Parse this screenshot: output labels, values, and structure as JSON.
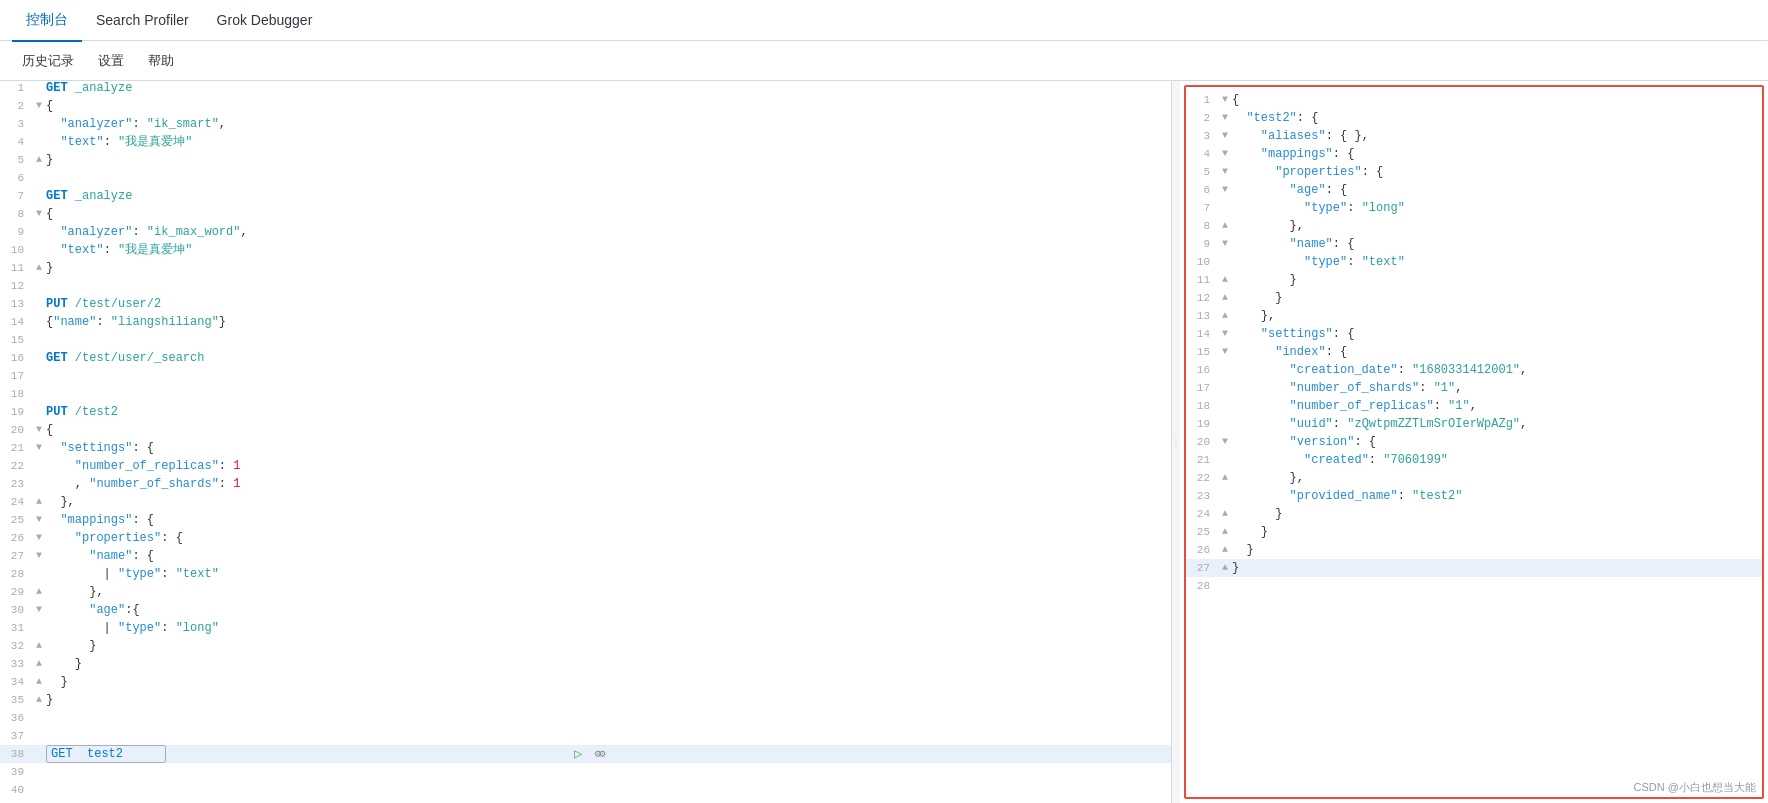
{
  "nav": {
    "tabs": [
      {
        "id": "console",
        "label": "控制台",
        "active": true
      },
      {
        "id": "search-profiler",
        "label": "Search Profiler",
        "active": false
      },
      {
        "id": "grok-debugger",
        "label": "Grok Debugger",
        "active": false
      }
    ]
  },
  "toolbar": {
    "history_label": "历史记录",
    "settings_label": "设置",
    "help_label": "帮助"
  },
  "editor": {
    "lines": [
      {
        "num": 1,
        "fold": "",
        "content": "GET _analyze",
        "classes": [
          "c-method-path"
        ]
      },
      {
        "num": 2,
        "fold": "▼",
        "content": "{",
        "classes": []
      },
      {
        "num": 3,
        "fold": "",
        "content": "  \"analyzer\": \"ik_smart\",",
        "classes": []
      },
      {
        "num": 4,
        "fold": "",
        "content": "  \"text\": \"我是真爱坤\"",
        "classes": []
      },
      {
        "num": 5,
        "fold": "▲",
        "content": "}",
        "classes": []
      },
      {
        "num": 6,
        "fold": "",
        "content": "",
        "classes": []
      },
      {
        "num": 7,
        "fold": "",
        "content": "GET _analyze",
        "classes": []
      },
      {
        "num": 8,
        "fold": "▼",
        "content": "{",
        "classes": []
      },
      {
        "num": 9,
        "fold": "",
        "content": "  \"analyzer\": \"ik_max_word\",",
        "classes": []
      },
      {
        "num": 10,
        "fold": "",
        "content": "  \"text\": \"我是真爱坤\"",
        "classes": []
      },
      {
        "num": 11,
        "fold": "▲",
        "content": "}",
        "classes": []
      },
      {
        "num": 12,
        "fold": "",
        "content": "",
        "classes": []
      },
      {
        "num": 13,
        "fold": "",
        "content": "PUT /test/user/2",
        "classes": []
      },
      {
        "num": 14,
        "fold": "",
        "content": "{\"name\":\"liangshiliang\"}",
        "classes": []
      },
      {
        "num": 15,
        "fold": "",
        "content": "",
        "classes": []
      },
      {
        "num": 16,
        "fold": "",
        "content": "GET /test/user/_search",
        "classes": []
      },
      {
        "num": 17,
        "fold": "",
        "content": "",
        "classes": []
      },
      {
        "num": 18,
        "fold": "",
        "content": "",
        "classes": []
      },
      {
        "num": 19,
        "fold": "",
        "content": "PUT /test2",
        "classes": []
      },
      {
        "num": 20,
        "fold": "▼",
        "content": "{",
        "classes": []
      },
      {
        "num": 21,
        "fold": "▼",
        "content": "  \"settings\": {",
        "classes": []
      },
      {
        "num": 22,
        "fold": "",
        "content": "    \"number_of_replicas\": 1",
        "classes": []
      },
      {
        "num": 23,
        "fold": "",
        "content": "    , \"number_of_shards\": 1",
        "classes": []
      },
      {
        "num": 24,
        "fold": "▲",
        "content": "  },",
        "classes": []
      },
      {
        "num": 25,
        "fold": "▼",
        "content": "  \"mappings\": {",
        "classes": []
      },
      {
        "num": 26,
        "fold": "▼",
        "content": "    \"properties\": {",
        "classes": []
      },
      {
        "num": 27,
        "fold": "▼",
        "content": "      \"name\": {",
        "classes": []
      },
      {
        "num": 28,
        "fold": "",
        "content": "        | \"type\": \"text\"",
        "classes": []
      },
      {
        "num": 29,
        "fold": "▲",
        "content": "      },",
        "classes": []
      },
      {
        "num": 30,
        "fold": "▼",
        "content": "      \"age\":{",
        "classes": []
      },
      {
        "num": 31,
        "fold": "",
        "content": "        | \"type\": \"long\"",
        "classes": []
      },
      {
        "num": 32,
        "fold": "▲",
        "content": "      }",
        "classes": []
      },
      {
        "num": 33,
        "fold": "▲",
        "content": "    }",
        "classes": []
      },
      {
        "num": 34,
        "fold": "▲",
        "content": "  }",
        "classes": []
      },
      {
        "num": 35,
        "fold": "▲",
        "content": "}",
        "classes": []
      },
      {
        "num": 36,
        "fold": "",
        "content": "",
        "classes": []
      },
      {
        "num": 37,
        "fold": "",
        "content": "",
        "classes": []
      },
      {
        "num": 38,
        "fold": "",
        "content": "GET  test2",
        "classes": [
          "active-line"
        ],
        "is_input": true
      },
      {
        "num": 39,
        "fold": "",
        "content": "",
        "classes": []
      },
      {
        "num": 40,
        "fold": "",
        "content": "",
        "classes": []
      }
    ]
  },
  "result": {
    "lines": [
      {
        "num": 1,
        "fold": "▼",
        "content": "{"
      },
      {
        "num": 2,
        "fold": "▼",
        "content": "  \"test2\" : {"
      },
      {
        "num": 3,
        "fold": "▼",
        "content": "    \"aliases\" : { },"
      },
      {
        "num": 4,
        "fold": "▼",
        "content": "    \"mappings\" : {"
      },
      {
        "num": 5,
        "fold": "▼",
        "content": "      \"properties\" : {"
      },
      {
        "num": 6,
        "fold": "▼",
        "content": "        \"age\" : {"
      },
      {
        "num": 7,
        "fold": "",
        "content": "          \"type\" : \"long\""
      },
      {
        "num": 8,
        "fold": "▲",
        "content": "        },"
      },
      {
        "num": 9,
        "fold": "▼",
        "content": "        \"name\" : {"
      },
      {
        "num": 10,
        "fold": "",
        "content": "          \"type\" : \"text\""
      },
      {
        "num": 11,
        "fold": "▲",
        "content": "        }"
      },
      {
        "num": 12,
        "fold": "▲",
        "content": "      }"
      },
      {
        "num": 13,
        "fold": "▲",
        "content": "    },"
      },
      {
        "num": 14,
        "fold": "▼",
        "content": "    \"settings\" : {"
      },
      {
        "num": 15,
        "fold": "▼",
        "content": "      \"index\" : {"
      },
      {
        "num": 16,
        "fold": "",
        "content": "        \"creation_date\" : \"1680331412001\","
      },
      {
        "num": 17,
        "fold": "",
        "content": "        \"number_of_shards\" : \"1\","
      },
      {
        "num": 18,
        "fold": "",
        "content": "        \"number_of_replicas\" : \"1\","
      },
      {
        "num": 19,
        "fold": "",
        "content": "        \"uuid\" : \"zQwtpmZZTLmSrOIerWpAZg\","
      },
      {
        "num": 20,
        "fold": "▼",
        "content": "        \"version\" : {"
      },
      {
        "num": 21,
        "fold": "",
        "content": "          \"created\" : \"7060199\""
      },
      {
        "num": 22,
        "fold": "▲",
        "content": "        },"
      },
      {
        "num": 23,
        "fold": "",
        "content": "        \"provided_name\" : \"test2\""
      },
      {
        "num": 24,
        "fold": "▲",
        "content": "      }"
      },
      {
        "num": 25,
        "fold": "▲",
        "content": "    }"
      },
      {
        "num": 26,
        "fold": "▲",
        "content": "  }"
      },
      {
        "num": 27,
        "fold": "▲",
        "content": "}"
      },
      {
        "num": 28,
        "fold": "",
        "content": ""
      }
    ]
  },
  "watermark": "CSDN @小白也想当大能"
}
